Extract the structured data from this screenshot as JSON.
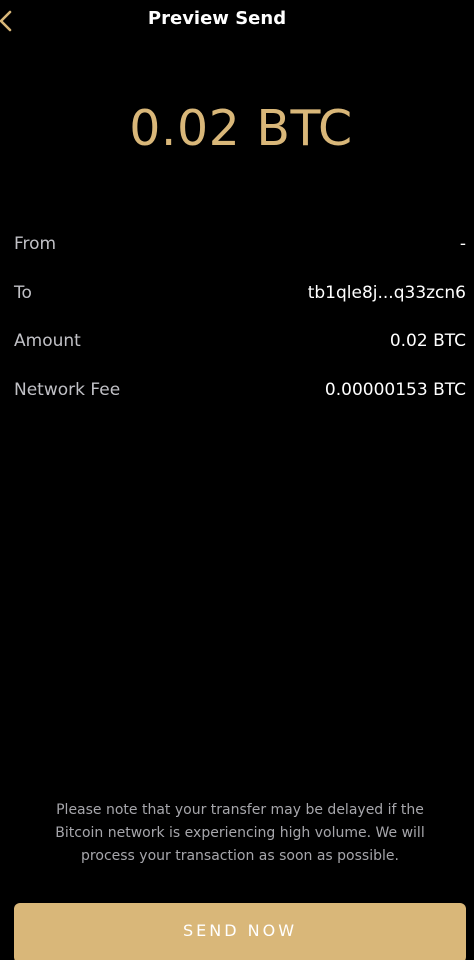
{
  "header": {
    "title": "Preview Send",
    "back_icon": "chevron-left-icon"
  },
  "amount_display": "0.02 BTC",
  "details": {
    "from": {
      "label": "From",
      "value": "-"
    },
    "to": {
      "label": "To",
      "value": "tb1qle8j...q33zcn6"
    },
    "amount": {
      "label": "Amount",
      "value": "0.02 BTC"
    },
    "network_fee": {
      "label": "Network Fee",
      "value": "0.00000153 BTC"
    }
  },
  "notice": "Please note that your transfer may be delayed if the Bitcoin network is experiencing high volume. We will process your transaction as soon as possible.",
  "send_button": {
    "label": "SEND NOW"
  },
  "colors": {
    "background": "#000000",
    "accent_gold": "#d9b779",
    "label_gray": "#c1c1c6",
    "notice_gray": "#a6a6ab",
    "text_white": "#ffffff"
  }
}
